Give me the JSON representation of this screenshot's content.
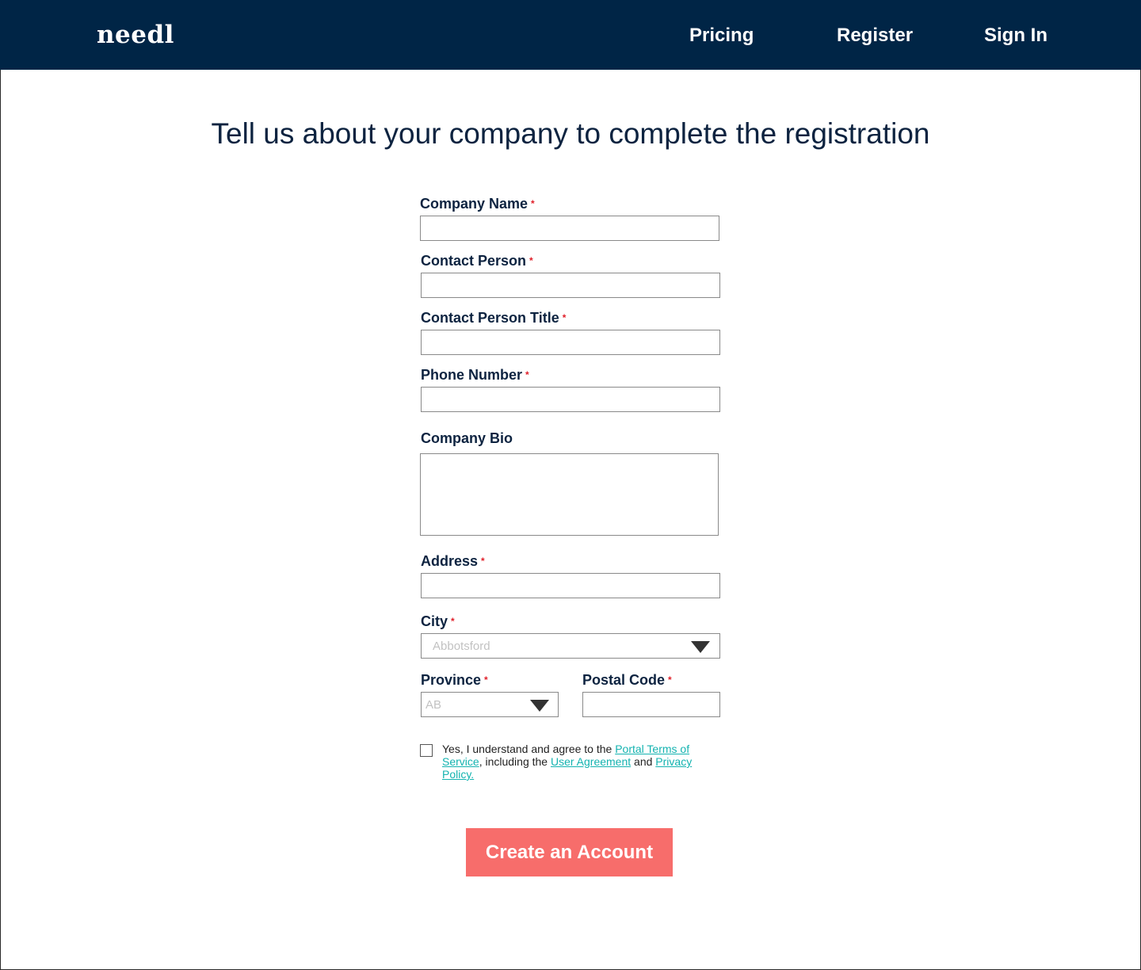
{
  "header": {
    "logo": "needl",
    "nav": {
      "pricing": "Pricing",
      "register": "Register",
      "sign_in": "Sign In"
    }
  },
  "page_title": "Tell us about your company to complete the registration",
  "required_marker": "*",
  "form": {
    "company_name_label": "Company Name",
    "contact_person_label": "Contact Person",
    "contact_person_title_label": "Contact Person Title",
    "phone_number_label": "Phone Number",
    "company_bio_label": "Company Bio",
    "address_label": "Address",
    "city_label": "City",
    "city_value": "Abbotsford",
    "province_label": "Province",
    "province_value": "AB",
    "postal_code_label": "Postal Code"
  },
  "terms": {
    "prefix": "Yes, I understand and agree to the ",
    "terms_link": "Portal Terms of Service",
    "middle": ", including the ",
    "agreement_link": "User Agreement",
    "and_text": " and ",
    "privacy_link": "Privacy Policy."
  },
  "submit_label": "Create an Account",
  "colors": {
    "navbar": "#002546",
    "heading_text": "#0d2340",
    "required": "#e0202a",
    "link": "#14b3b0",
    "cta": "#f76d6b"
  },
  "icons": {
    "dropdown": "caret-down-icon"
  }
}
